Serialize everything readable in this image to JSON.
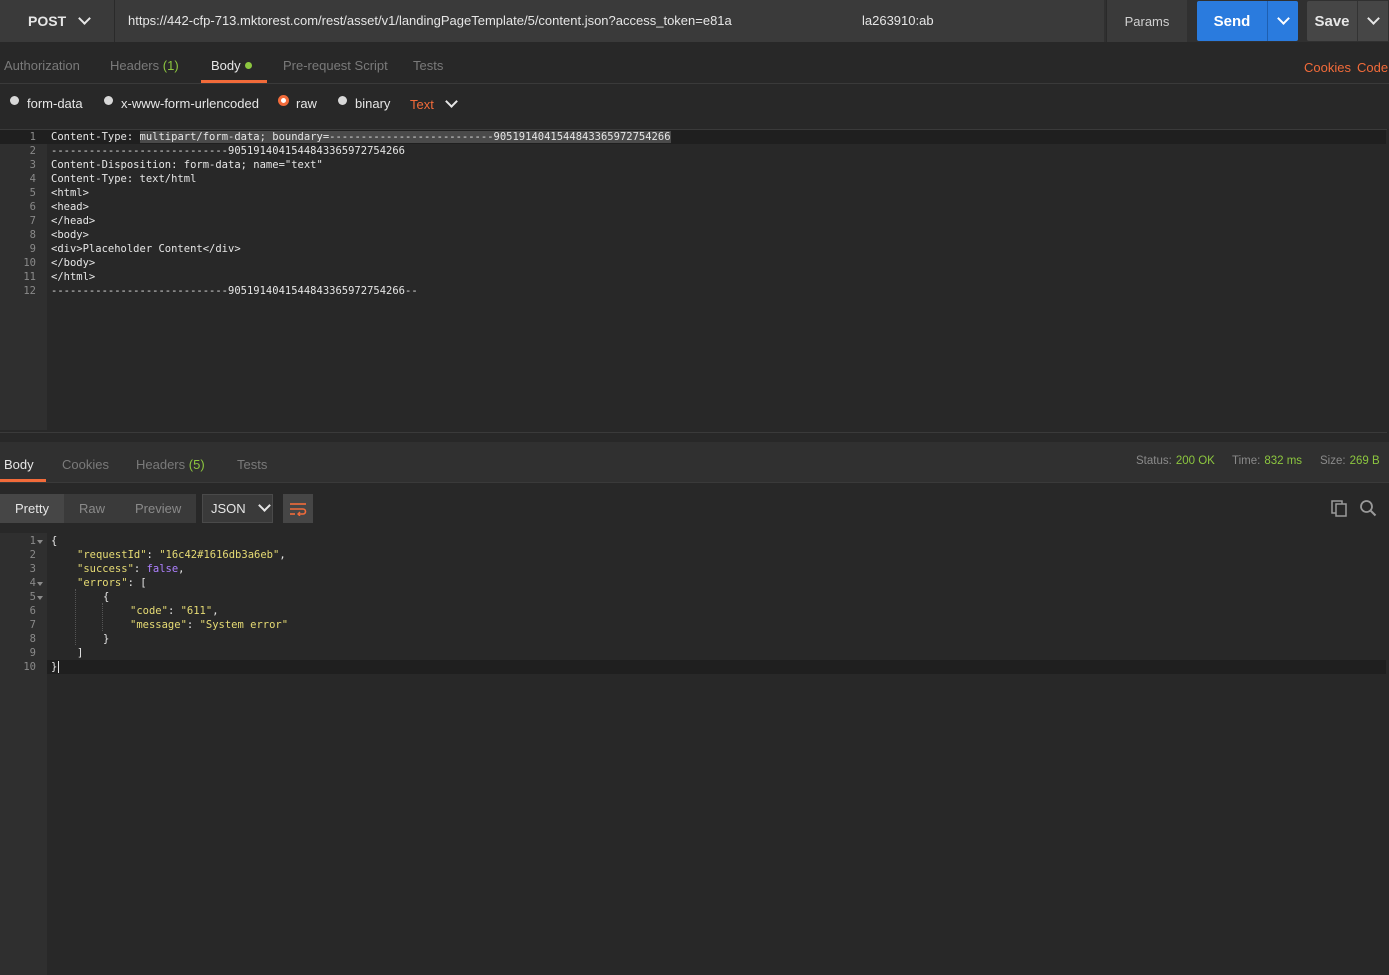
{
  "request": {
    "method": "POST",
    "url": "https://442-cfp-713.mktorest.com/rest/asset/v1/landingPageTemplate/5/content.json?access_token=e81a",
    "url_tail": "la263910:ab",
    "params_label": "Params",
    "send_label": "Send",
    "save_label": "Save"
  },
  "request_tabs": {
    "authorization": "Authorization",
    "headers": "Headers",
    "headers_count": "(1)",
    "body": "Body",
    "prerequest": "Pre-request Script",
    "tests": "Tests",
    "cookies": "Cookies",
    "code": "Code"
  },
  "body_options": {
    "form_data": "form-data",
    "urlencoded": "x-www-form-urlencoded",
    "raw": "raw",
    "binary": "binary",
    "type": "Text"
  },
  "request_body": {
    "line1_prefix": "Content-Type: ",
    "line1_selected": "multipart/form-data; boundary=--------------------------905191404154484336597275426​6",
    "lines": [
      "----------------------------905191404154484336597275426​6",
      "Content-Disposition: form-data; name=\"text\"",
      "Content-Type: text/html",
      "<html>",
      "<head>",
      "</head>",
      "<body>",
      "<div>Placeholder Content</div>",
      "</body>",
      "</html>",
      "----------------------------905191404154484336597275426​6--"
    ],
    "line_numbers": [
      "1",
      "2",
      "3",
      "4",
      "5",
      "6",
      "7",
      "8",
      "9",
      "10",
      "11",
      "12"
    ]
  },
  "response_tabs": {
    "body": "Body",
    "cookies": "Cookies",
    "headers": "Headers",
    "headers_count": "(5)",
    "tests": "Tests"
  },
  "response_meta": {
    "status_label": "Status:",
    "status_value": "200 OK",
    "time_label": "Time:",
    "time_value": "832 ms",
    "size_label": "Size:",
    "size_value": "269 B"
  },
  "response_view": {
    "pretty": "Pretty",
    "raw": "Raw",
    "preview": "Preview",
    "format": "JSON"
  },
  "response_body": {
    "line_numbers": [
      "1",
      "2",
      "3",
      "4",
      "5",
      "6",
      "7",
      "8",
      "9",
      "10"
    ],
    "open_brace": "{",
    "request_id_key": "\"requestId\"",
    "request_id_val": "\"16c42#1616db3a6eb\"",
    "success_key": "\"success\"",
    "success_val": "false",
    "errors_key": "\"errors\"",
    "open_bracket": "[",
    "inner_open": "{",
    "code_key": "\"code\"",
    "code_val": "\"611\"",
    "message_key": "\"message\"",
    "message_val": "\"System error\"",
    "inner_close": "}",
    "close_bracket": "]",
    "close_brace": "}"
  },
  "colors": {
    "accent": "#f26b3a",
    "send": "#2a7bde",
    "green": "#8cc63f"
  }
}
